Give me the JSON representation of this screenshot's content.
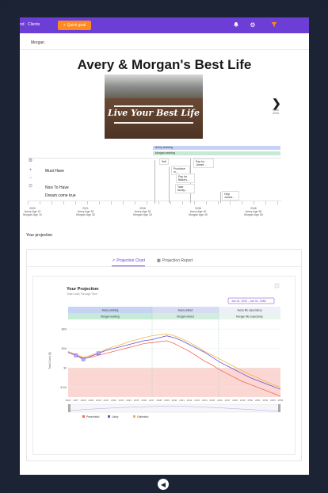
{
  "topbar": {
    "nav_a": "nd",
    "nav_b": "Clients",
    "quick_goal_label": "Quick goal",
    "icons": [
      "bell-icon",
      "gear-icon",
      "funnel-icon"
    ]
  },
  "breadcrumb": "Morgan",
  "page_title": "Avery & Morgan's Best Life",
  "hero_caption": "Live Your Best Life",
  "next": {
    "label": "Next 2043"
  },
  "timeline": {
    "bars": [
      {
        "label": "Avery working",
        "color": "#c7d3f5"
      },
      {
        "label": "Morgan working",
        "color": "#c5ead8"
      }
    ],
    "rows": [
      "Must Have",
      "Nice To Have",
      "Dream come true"
    ],
    "goals": [
      "Sell",
      "Purchase m...",
      "Pay for James'...",
      "Pay for Blake's...",
      "Take family...",
      "Help James..."
    ],
    "axis": [
      {
        "years": "2009",
        "avery": "Avery Age 10",
        "morgan": "Morgan Age 10"
      },
      {
        "years": "2021",
        "avery": "Avery Age 32",
        "morgan": "Morgan Age 32"
      },
      {
        "years": "2026",
        "avery": "Avery Age 33",
        "morgan": "Morgan Age 33"
      },
      {
        "years": "2036",
        "avery": "Avery Age 40",
        "morgan": "Morgan Age 40"
      },
      {
        "years": "2046",
        "avery": "Avery Age 50",
        "morgan": "Morgan Age 50"
      }
    ]
  },
  "section_label": "Your projection",
  "tabs": {
    "chart": "Projection Chart",
    "report": "Projection Report"
  },
  "chart_data": {
    "type": "line",
    "title": "Your Projection",
    "subtitle": "Total Cash Through Time",
    "date_range": "Jan 01, 2022 - Jan 01, 2083",
    "ylabel": "Total Cash ($)",
    "y_ticks": [
      "$4M",
      "$2M",
      "$0",
      "$-2M"
    ],
    "phase_rows": [
      [
        "Avery working",
        "Avery retired",
        "Avery life expectancy"
      ],
      [
        "Morgan working",
        "Morgan retired",
        "Morgan life expectancy"
      ]
    ],
    "x": [
      "2026",
      "2027",
      "2028",
      "2029",
      "2030",
      "2031",
      "2032",
      "2033",
      "2034",
      "2035",
      "2036",
      "2037",
      "2038",
      "2039",
      "2040",
      "2041",
      "2042",
      "2043",
      "2044",
      "2045",
      "2046",
      "2047",
      "2048",
      "2049",
      "2050",
      "2051",
      "2052",
      "2053",
      "2054"
    ],
    "series": [
      {
        "name": "Pessimistic",
        "color": "#f26b5b",
        "values": [
          1.6,
          1.3,
          1.0,
          1.1,
          1.3,
          1.5,
          1.7,
          1.9,
          2.1,
          2.3,
          2.5,
          2.6,
          2.7,
          2.8,
          2.5,
          2.1,
          1.7,
          1.2,
          0.7,
          0.3,
          -0.2,
          -0.6,
          -1.0,
          -1.4,
          -1.7,
          -2.0,
          -2.3,
          -2.6,
          -2.9
        ]
      },
      {
        "name": "Likely",
        "color": "#6d4fd8",
        "values": [
          1.6,
          1.3,
          0.9,
          1.2,
          1.5,
          1.8,
          2.0,
          2.2,
          2.4,
          2.6,
          2.8,
          2.9,
          3.1,
          3.3,
          3.1,
          2.8,
          2.4,
          2.0,
          1.6,
          1.1,
          0.6,
          0.2,
          -0.2,
          -0.6,
          -1.0,
          -1.3,
          -1.6,
          -1.9,
          -2.2
        ]
      },
      {
        "name": "Optimistic",
        "color": "#f0b542",
        "values": [
          1.7,
          1.4,
          1.1,
          1.3,
          1.6,
          1.9,
          2.2,
          2.4,
          2.7,
          2.9,
          3.1,
          3.3,
          3.4,
          3.5,
          3.3,
          3.0,
          2.6,
          2.2,
          1.7,
          1.3,
          0.9,
          0.5,
          0.1,
          -0.3,
          -0.7,
          -1.0,
          -1.4,
          -1.7,
          -2.0
        ]
      }
    ],
    "ylim": [
      -3,
      4.5
    ],
    "legend": "bottom-left"
  }
}
